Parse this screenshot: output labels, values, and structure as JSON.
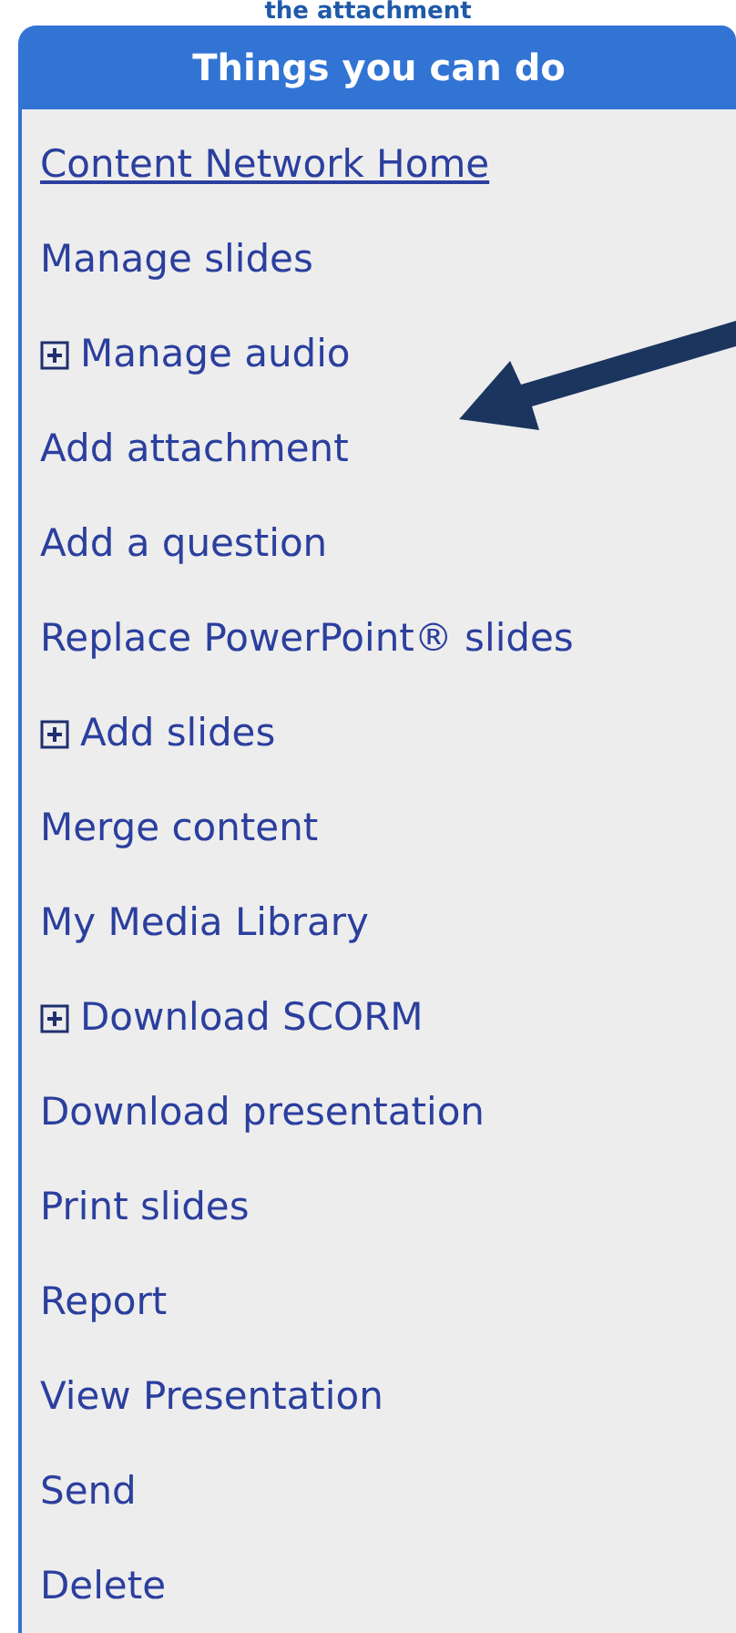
{
  "caption": "the attachment",
  "panel": {
    "title": "Things you can do",
    "items": [
      {
        "label": "Content Network Home",
        "kind": "link"
      },
      {
        "label": "Manage slides",
        "kind": "action"
      },
      {
        "label": "Manage audio",
        "kind": "expandable",
        "expanded": false
      },
      {
        "label": "Add attachment",
        "kind": "action"
      },
      {
        "label": "Add a question",
        "kind": "action"
      },
      {
        "label": "Replace PowerPoint® slides",
        "kind": "action"
      },
      {
        "label": "Add slides",
        "kind": "expandable",
        "expanded": false
      },
      {
        "label": "Merge content",
        "kind": "action"
      },
      {
        "label": "My Media Library",
        "kind": "action"
      },
      {
        "label": "Download SCORM",
        "kind": "expandable",
        "expanded": false
      },
      {
        "label": "Download presentation",
        "kind": "action"
      },
      {
        "label": "Print slides",
        "kind": "action"
      },
      {
        "label": "Report",
        "kind": "action"
      },
      {
        "label": "View Presentation",
        "kind": "action"
      },
      {
        "label": "Send",
        "kind": "action"
      },
      {
        "label": "Delete",
        "kind": "action"
      }
    ]
  }
}
